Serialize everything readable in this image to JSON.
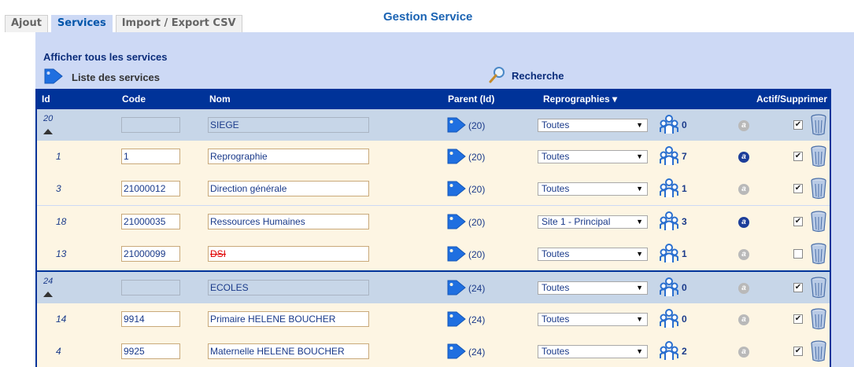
{
  "tabs": [
    {
      "label": "Ajout"
    },
    {
      "label": "Services"
    },
    {
      "label": "Import / Export CSV"
    }
  ],
  "page_title": "Gestion Service",
  "show_all_label": "Afficher tous les services",
  "list_label": "Liste des services",
  "search_label": "Recherche",
  "columns": {
    "id": "Id",
    "code": "Code",
    "name": "Nom",
    "parent": "Parent (Id)",
    "repro": "Reprographies ▾",
    "actions": "Actif/Supprimer"
  },
  "rows": [
    {
      "kind": "group",
      "id": "20",
      "code": "",
      "name": "SIEGE",
      "parent": "(20)",
      "repro": "Toutes",
      "count": "0",
      "a": "a",
      "a_active": false,
      "checked": true
    },
    {
      "kind": "child",
      "id": "1",
      "code": "1",
      "name": "Reprographie",
      "parent": "(20)",
      "repro": "Toutes",
      "count": "7",
      "a": "a",
      "a_active": true,
      "checked": true
    },
    {
      "kind": "child",
      "id": "3",
      "code": "21000012",
      "name": "Direction générale",
      "parent": "(20)",
      "repro": "Toutes",
      "count": "1",
      "a": "a",
      "a_active": false,
      "checked": true
    },
    {
      "kind": "child",
      "id": "18",
      "code": "21000035",
      "name": "Ressources Humaines",
      "parent": "(20)",
      "repro": "Site 1 - Principal",
      "count": "3",
      "a": "a",
      "a_active": true,
      "checked": true
    },
    {
      "kind": "child",
      "id": "13",
      "code": "21000099",
      "name": "DSI",
      "strike": true,
      "parent": "(20)",
      "repro": "Toutes",
      "count": "1",
      "a": "a",
      "a_active": false,
      "checked": false
    },
    {
      "kind": "group",
      "id": "24",
      "code": "",
      "name": "ECOLES",
      "parent": "(24)",
      "repro": "Toutes",
      "count": "0",
      "a": "a",
      "a_active": false,
      "checked": true
    },
    {
      "kind": "child",
      "id": "14",
      "code": "9914",
      "name": "Primaire HELENE BOUCHER",
      "parent": "(24)",
      "repro": "Toutes",
      "count": "0",
      "a": "a",
      "a_active": false,
      "checked": true
    },
    {
      "kind": "child",
      "id": "4",
      "code": "9925",
      "name": "Maternelle HELENE BOUCHER",
      "parent": "(24)",
      "repro": "Toutes",
      "count": "2",
      "a": "a",
      "a_active": false,
      "checked": true
    }
  ],
  "colors": {
    "header_bg": "#003399",
    "panel_bg": "#cdd9f5",
    "group_row_bg": "#c7d6e8",
    "child_row_bg": "#fdf5e3"
  }
}
